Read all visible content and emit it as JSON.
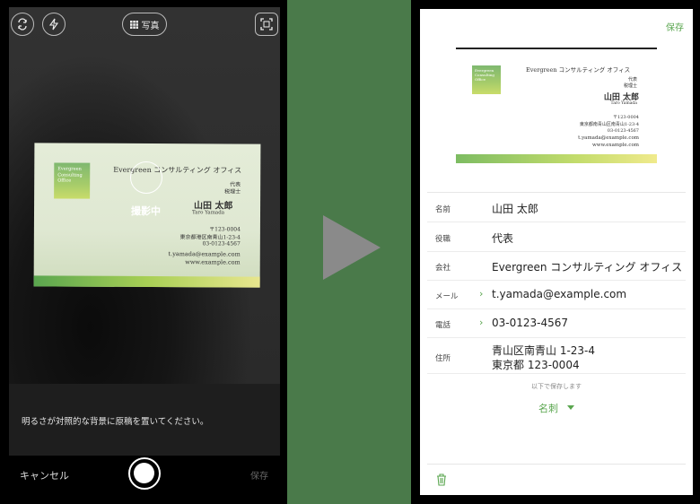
{
  "left": {
    "doc_type_label": "写真",
    "shooting_label": "撮影中",
    "hint": "明るさが対照的な背景に原稿を置いてください。",
    "cancel": "キャンセル",
    "save": "保存",
    "card": {
      "company": "Evergreen コンサルティング オフィス",
      "title1": "代表",
      "title2": "税理士",
      "name": "山田 太郎",
      "romaji": "Taro Yamada",
      "postal": "〒123-0004",
      "address": "東京都港区南青山1-23-4",
      "phone": "03-0123-4567",
      "email": "t.yamada@example.com",
      "web": "www.example.com",
      "logo": "Evergreen Consulting Office"
    }
  },
  "right": {
    "save": "保存",
    "card": {
      "company": "Evergreen コンサルティング オフィス",
      "title1": "代表",
      "title2": "税理士",
      "name": "山田 太郎",
      "romaji": "Taro Yamada",
      "postal": "〒123-0004",
      "address": "東京都南青山区南青山1-23-4",
      "phone": "03-0123-4567",
      "email": "t.yamada@example.com",
      "web": "www.example.com",
      "logo": "Evergreen Consulting Office"
    },
    "fields": {
      "name_label": "名前",
      "name_value": "山田 太郎",
      "role_label": "役職",
      "role_value": "代表",
      "company_label": "会社",
      "company_value": "Evergreen コンサルティング オフィス",
      "mail_label": "メール",
      "mail_value": "t.yamada@example.com",
      "phone_label": "電話",
      "phone_value": "03-0123-4567",
      "address_label": "住所",
      "address_line1": "青山区南青山 1-23-4",
      "address_line2": "東京都 123-0004"
    },
    "save_below": "以下で保存します",
    "save_type": "名刺"
  },
  "colors": {
    "accent": "#5aa64f",
    "background": "#4a7a4a"
  }
}
